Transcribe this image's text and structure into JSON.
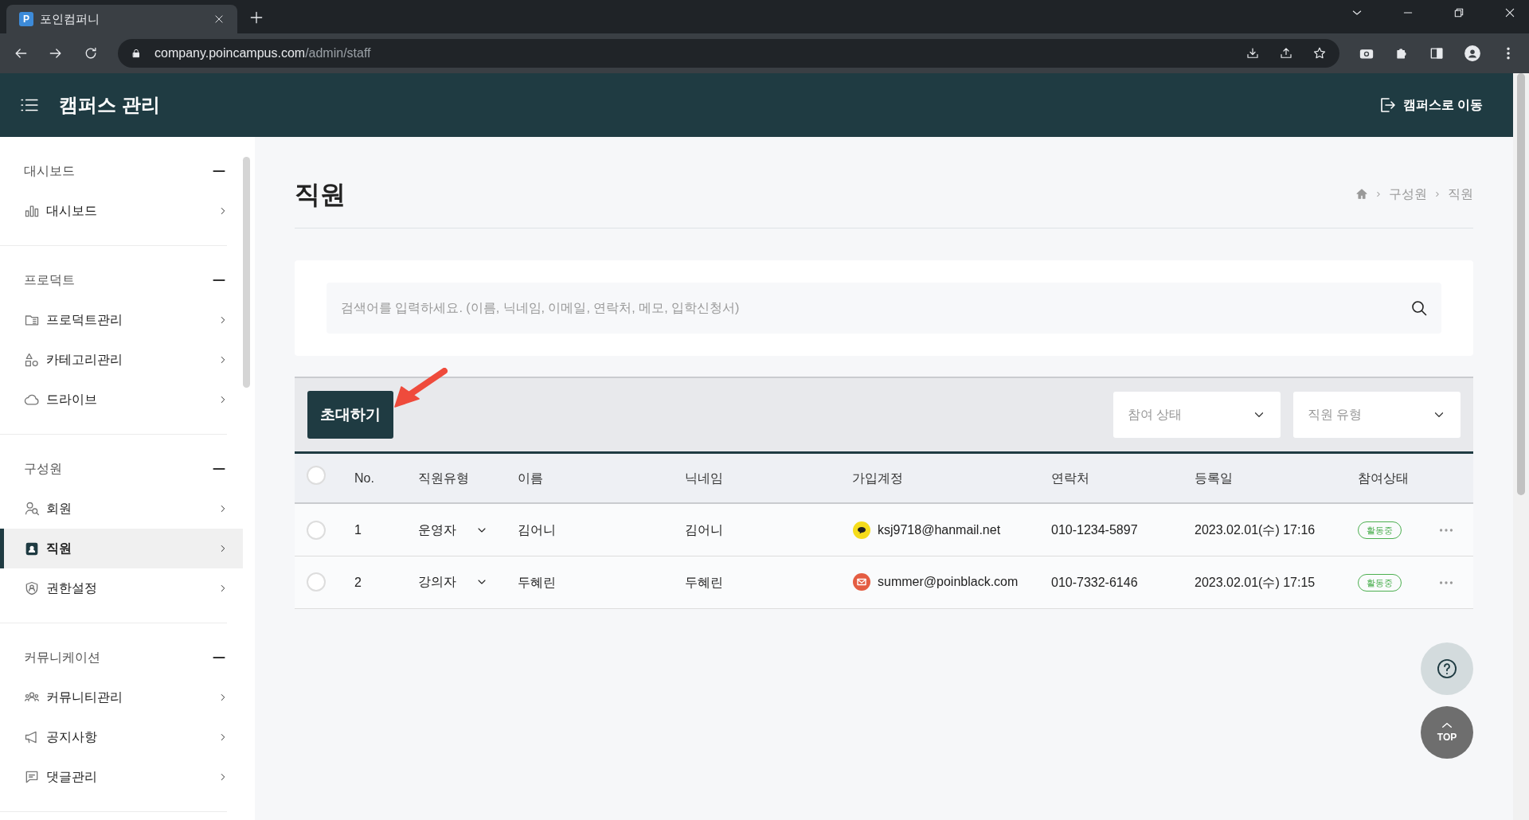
{
  "browser": {
    "tab_title": "포인컴퍼니",
    "favicon_letter": "P",
    "url_host": "company.poincampus.com",
    "url_path": "/admin/staff"
  },
  "header": {
    "title": "캠퍼스 관리",
    "link": "캠퍼스로 이동"
  },
  "sidebar": {
    "sections": [
      {
        "title": "대시보드",
        "expanded": true,
        "items": [
          {
            "label": "대시보드",
            "selected": false
          }
        ]
      },
      {
        "title": "프로덕트",
        "expanded": true,
        "items": [
          {
            "label": "프로덕트관리",
            "selected": false
          },
          {
            "label": "카테고리관리",
            "selected": false
          },
          {
            "label": "드라이브",
            "selected": false
          }
        ]
      },
      {
        "title": "구성원",
        "expanded": true,
        "items": [
          {
            "label": "회원",
            "selected": false
          },
          {
            "label": "직원",
            "selected": true
          },
          {
            "label": "권한설정",
            "selected": false
          }
        ]
      },
      {
        "title": "커뮤니케이션",
        "expanded": true,
        "items": [
          {
            "label": "커뮤니티관리",
            "selected": false
          },
          {
            "label": "공지사항",
            "selected": false
          },
          {
            "label": "댓글관리",
            "selected": false
          }
        ]
      }
    ]
  },
  "page": {
    "title": "직원",
    "breadcrumb": [
      "구성원",
      "직원"
    ]
  },
  "search": {
    "placeholder": "검색어를 입력하세요. (이름, 닉네임, 이메일, 연락처, 메모, 입학신청서)"
  },
  "toolbar": {
    "invite_button": "초대하기",
    "filters": [
      {
        "placeholder": "참여 상태"
      },
      {
        "placeholder": "직원 유형"
      }
    ]
  },
  "table": {
    "select_all_checked": false,
    "columns": [
      "No.",
      "직원유형",
      "이름",
      "닉네임",
      "가입계정",
      "연락처",
      "등록일",
      "참여상태"
    ],
    "rows": [
      {
        "checked": false,
        "no": "1",
        "type": "운영자",
        "name": "김어니",
        "nickname": "김어니",
        "kind": "chat",
        "account": "ksj9718@hanmail.net",
        "phone": "010-1234-5897",
        "date": "2023.02.01(수) 17:16",
        "status": "활동중"
      },
      {
        "checked": false,
        "no": "2",
        "type": "강의자",
        "name": "두혜린",
        "nickname": "두혜린",
        "kind": "mail",
        "account": "summer@poinblack.com",
        "phone": "010-7332-6146",
        "date": "2023.02.01(수) 17:15",
        "status": "활동중"
      }
    ]
  },
  "floating": {
    "top_label": "TOP"
  }
}
